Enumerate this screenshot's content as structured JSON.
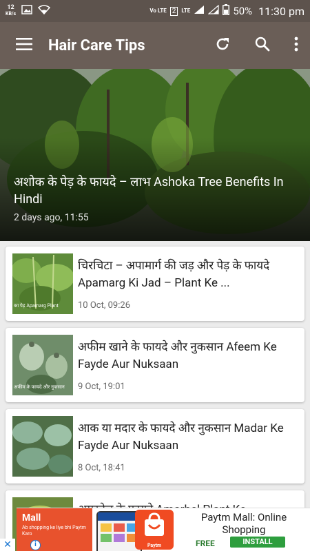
{
  "status_bar": {
    "speed_value": "12",
    "speed_unit": "KB/s",
    "volte": "Vo LTE",
    "sim_slot": "2",
    "lte": "LTE",
    "battery": "50%",
    "time": "11:30 pm"
  },
  "app_bar": {
    "title": "Hair Care Tips"
  },
  "featured": {
    "title": "अशोक के पेड़ के फायदे – लाभ Ashoka Tree Benefits In Hindi",
    "date": "2 days ago, 11:55"
  },
  "articles": [
    {
      "title": "चिरचिटा – अपामार्ग की जड़ और पेड़ के फायदे Apamarg Ki Jad – Plant Ke ...",
      "date": "10 Oct, 09:26",
      "thumb_caption": "का पेड़ Apamarg Plant"
    },
    {
      "title": "अफीम खाने के फायदे और नुकसान Afeem Ke Fayde Aur Nuksaan",
      "date": "9 Oct, 19:01",
      "thumb_caption": "अफीम के फायदे और नुकसान"
    },
    {
      "title": "आक या मदार के फायदे और नुकसान Madar Ke Fayde Aur Nuksaan",
      "date": "8 Oct, 18:41",
      "thumb_caption": ""
    },
    {
      "title": "अमरबेल के फायदे Amarbel Plant Ke",
      "date": "",
      "thumb_caption": ""
    }
  ],
  "ad": {
    "brand": "Mall",
    "tagline": "Ab shopping ke liye bhi Paytm Karo",
    "bag_label": "Paytm",
    "headline": "Paytm Mall: Online Shopping",
    "price": "FREE",
    "cta": "INSTALL",
    "close_icon": "close-icon",
    "info_icon": "info-icon"
  }
}
